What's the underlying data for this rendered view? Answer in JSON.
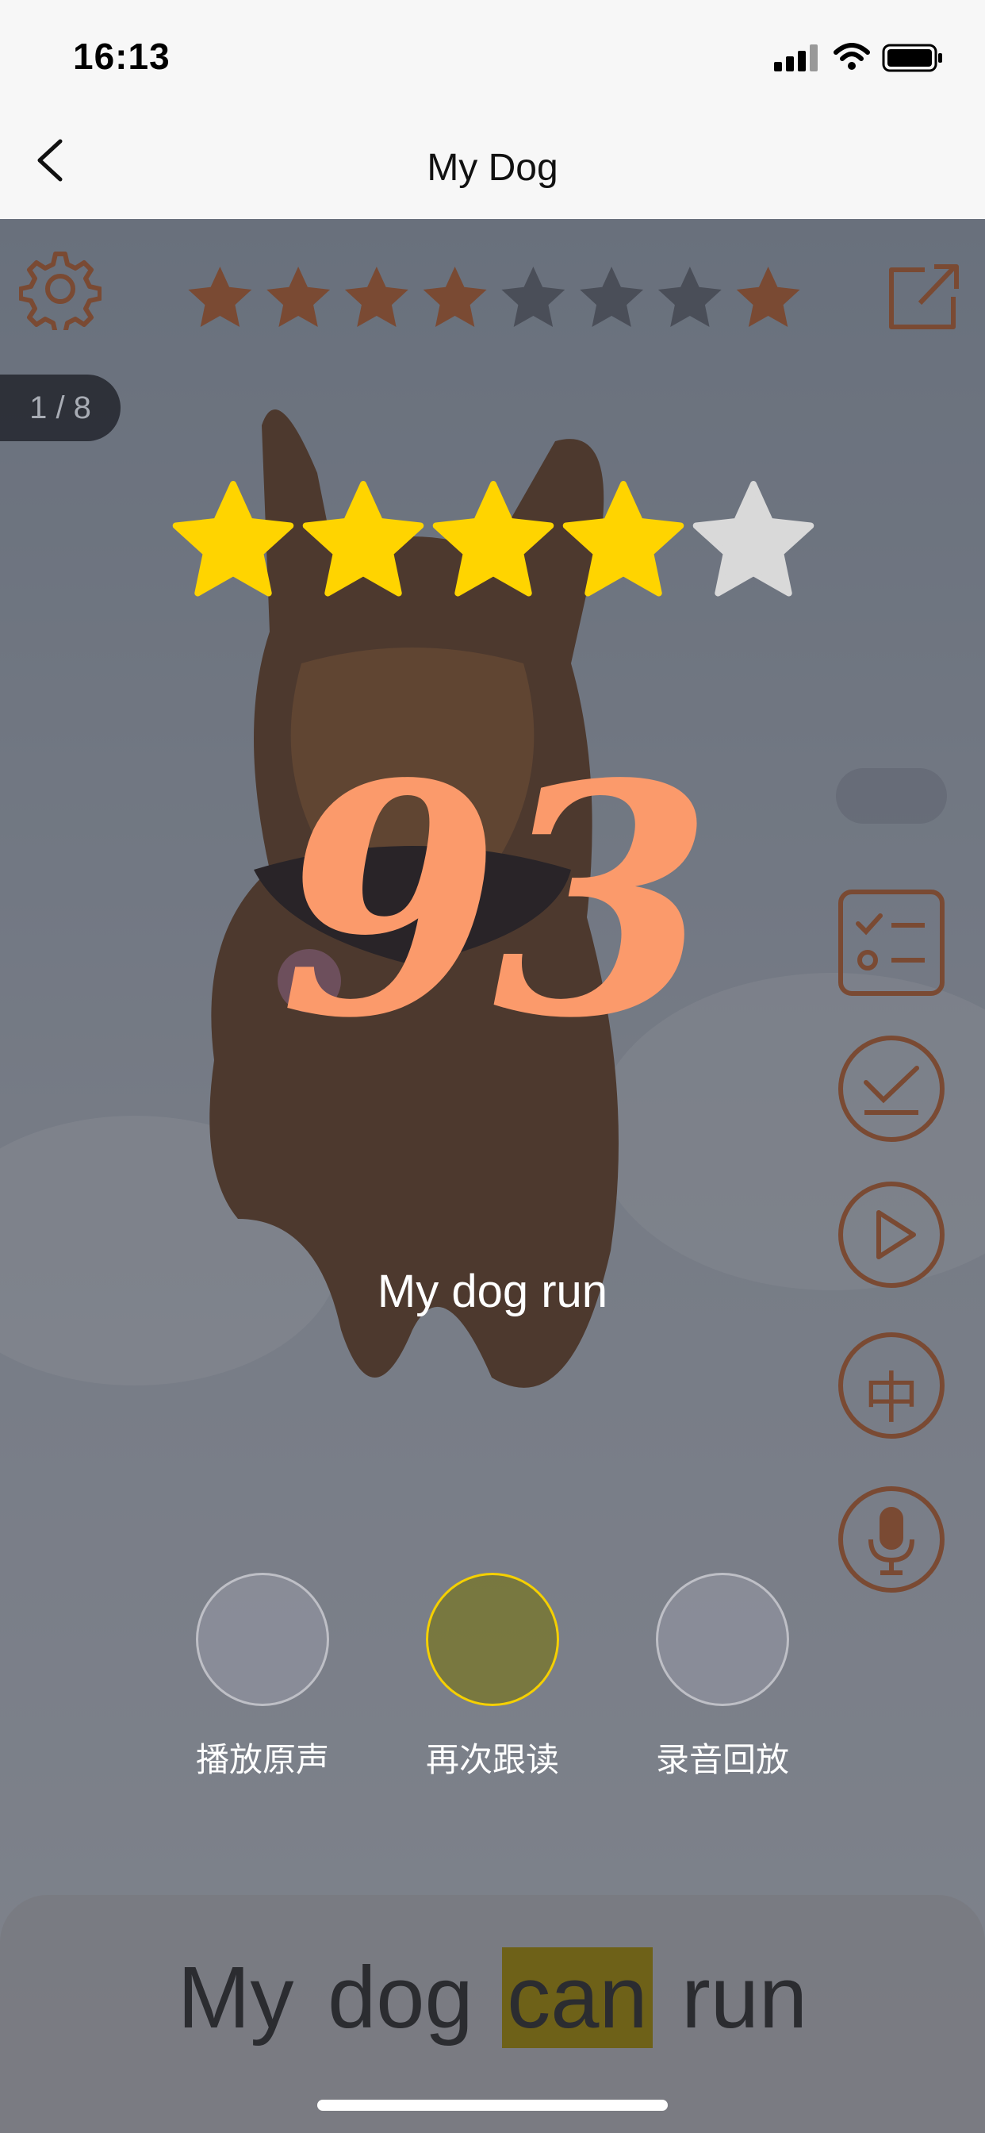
{
  "status_bar": {
    "time": "16:13"
  },
  "nav": {
    "title": "My Dog",
    "back_icon": "chevron-left-icon"
  },
  "toolbar": {
    "settings_icon": "gear-icon",
    "share_icon": "share-icon",
    "progress_stars": {
      "total": 8,
      "completed_indexes": [
        0,
        1,
        2,
        3,
        7
      ],
      "color": "#7a4a33"
    }
  },
  "page_indicator": {
    "text": "1 / 8"
  },
  "result": {
    "rating": 4,
    "rating_max": 5,
    "score": "93",
    "sentence": "My dog run",
    "star_color": "#ffd400",
    "empty_star_color": "#d9d9d9",
    "score_color": "#fb9a6b"
  },
  "side_tools": [
    {
      "name": "checklist-icon"
    },
    {
      "name": "check-circle-icon"
    },
    {
      "name": "play-icon"
    },
    {
      "name": "chinese-translate-icon",
      "glyph": "中"
    },
    {
      "name": "microphone-icon"
    }
  ],
  "actions": [
    {
      "label": "播放原声",
      "active": false
    },
    {
      "label": "再次跟读",
      "active": true
    },
    {
      "label": "录音回放",
      "active": false
    }
  ],
  "bottom": {
    "words": [
      "My",
      "dog",
      "can",
      "run"
    ],
    "highlight_index": 2
  },
  "colors": {
    "accent": "#8a4a2a",
    "highlight": "#f5d000"
  }
}
